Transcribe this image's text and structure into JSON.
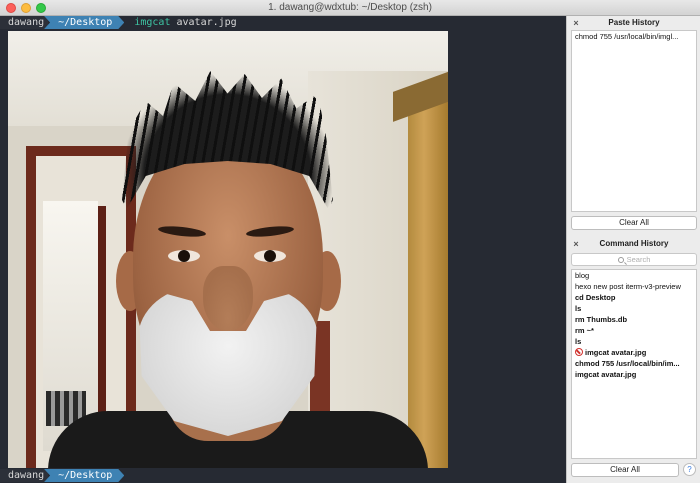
{
  "window": {
    "title": "1. dawang@wdxtub: ~/Desktop (zsh)"
  },
  "terminal": {
    "prompt_top": {
      "user": "dawang",
      "dir": "~/Desktop",
      "command": "imgcat",
      "argument": "avatar.jpg"
    },
    "prompt_bottom": {
      "user": "dawang",
      "dir": "~/Desktop"
    }
  },
  "paste_history": {
    "title": "Paste History",
    "close_icon": "×",
    "items": [
      "chmod 755 /usr/local/bin/imgl..."
    ],
    "clear_label": "Clear All"
  },
  "command_history": {
    "title": "Command History",
    "close_icon": "×",
    "search_placeholder": "Search",
    "items": [
      {
        "text": "blog",
        "bold": false
      },
      {
        "text": "hexo new post iterm-v3-preview",
        "bold": false
      },
      {
        "text": "cd Desktop",
        "bold": true
      },
      {
        "text": "ls",
        "bold": true
      },
      {
        "text": "rm Thumbs.db",
        "bold": true
      },
      {
        "text": "rm ~*",
        "bold": true
      },
      {
        "text": "ls",
        "bold": true
      },
      {
        "text": "imgcat avatar.jpg",
        "bold": true,
        "error": true
      },
      {
        "text": "chmod 755 /usr/local/bin/im...",
        "bold": true
      },
      {
        "text": "imgcat avatar.jpg",
        "bold": true
      }
    ],
    "clear_label": "Clear All",
    "help_label": "?"
  },
  "colors": {
    "terminal_bg": "#262a33",
    "dir_segment": "#3e82b3",
    "command_green": "#3ec4a3"
  }
}
